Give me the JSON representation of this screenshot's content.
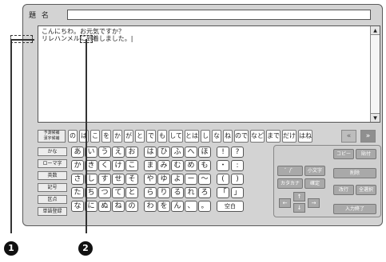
{
  "title": {
    "label": "題 名",
    "value": ""
  },
  "editor": {
    "lines": [
      "こんにちわ。お元気ですか？",
      "リレハンメルに到着しました。|"
    ]
  },
  "prediction": {
    "label": "予測候補\n漢字候補",
    "candidates": [
      "の",
      "は",
      "こ",
      "を",
      "か",
      "が",
      "と",
      "で",
      "も",
      "して",
      "とは",
      "し",
      "な",
      "ね",
      "ので",
      "など",
      "まで",
      "だけ",
      "はね"
    ],
    "prev": "«",
    "next": "»"
  },
  "modes": [
    "かな",
    "ローマ字",
    "英数",
    "記号",
    "区点",
    "単語登録"
  ],
  "kana_rows": [
    [
      "あ",
      "い",
      "う",
      "え",
      "お",
      "は",
      "ひ",
      "ふ",
      "へ",
      "ほ",
      "!",
      "?"
    ],
    [
      "か",
      "き",
      "く",
      "け",
      "こ",
      "ま",
      "み",
      "む",
      "め",
      "も",
      "・",
      ":"
    ],
    [
      "さ",
      "し",
      "す",
      "せ",
      "そ",
      "や",
      "ゆ",
      "よ",
      "ー",
      "〜",
      "(",
      ")"
    ],
    [
      "た",
      "ち",
      "つ",
      "て",
      "と",
      "ら",
      "り",
      "る",
      "れ",
      "ろ",
      "「",
      "」"
    ],
    [
      "な",
      "に",
      "ぬ",
      "ね",
      "の",
      "わ",
      "を",
      "ん",
      "、",
      "。",
      "空白",
      ""
    ]
  ],
  "right_panel": {
    "copy": "コピー",
    "paste": "貼付",
    "dakuten": "゛/゜",
    "small": "小文字",
    "delete": "削除",
    "katakana": "カタカナ",
    "confirm": "確定",
    "newline": "改行",
    "select_all": "全選択",
    "arrow_up": "↑",
    "arrow_left": "←",
    "arrow_down": "↓",
    "arrow_right": "→",
    "finish": "入力終了"
  },
  "callouts": {
    "one": "1",
    "two": "2"
  }
}
